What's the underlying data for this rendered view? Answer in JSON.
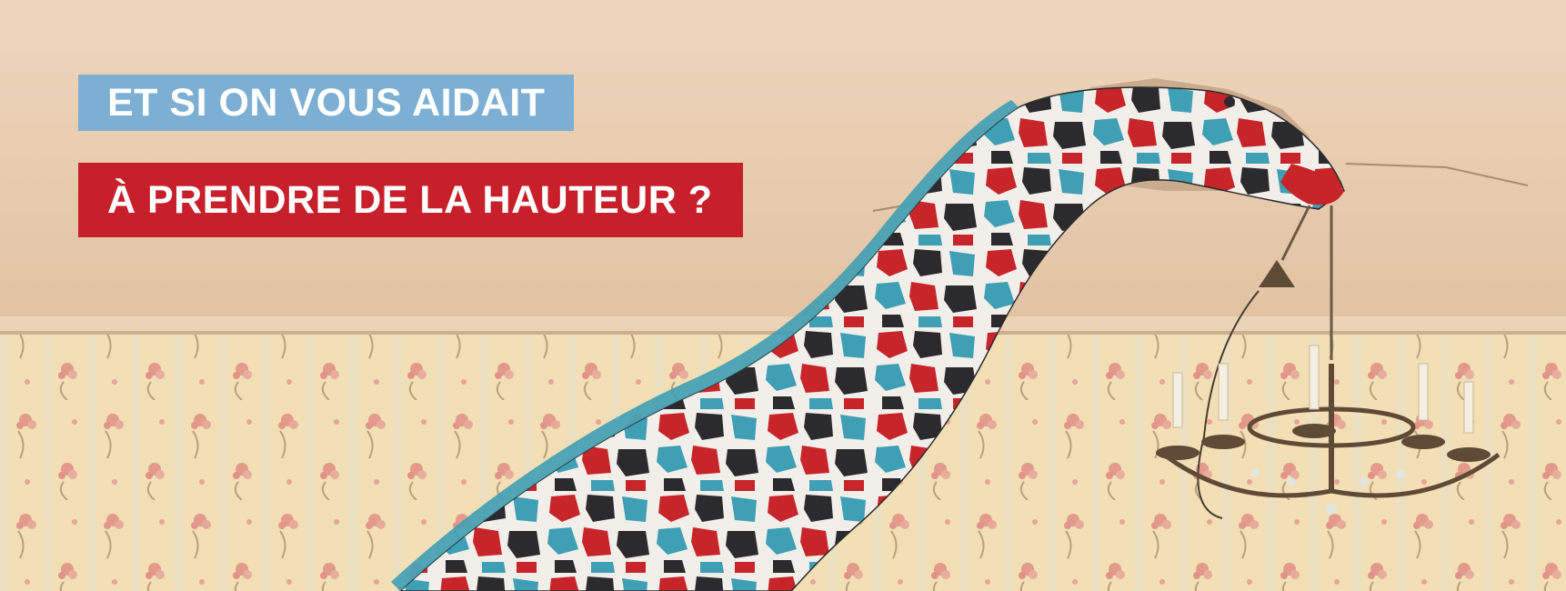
{
  "headline": {
    "line1": "ET SI ON VOUS AIDAIT",
    "line2": "À PRENDRE DE LA HAUTEUR ?"
  },
  "colors": {
    "line1_background": "#7cafd3",
    "line2_background": "#c8202b",
    "text": "#ffffff",
    "ceiling": "#e9cdb0",
    "wallpaper": "#f1dcb0",
    "giraffe_red": "#c8252b",
    "giraffe_blue": "#3f9fb4",
    "giraffe_dark": "#2b2b2e"
  },
  "scene": {
    "subject": "patchwork giraffe breaking through ceiling holding a chandelier",
    "icons": [
      "giraffe-illustration",
      "chandelier-illustration",
      "floral-wallpaper"
    ]
  }
}
